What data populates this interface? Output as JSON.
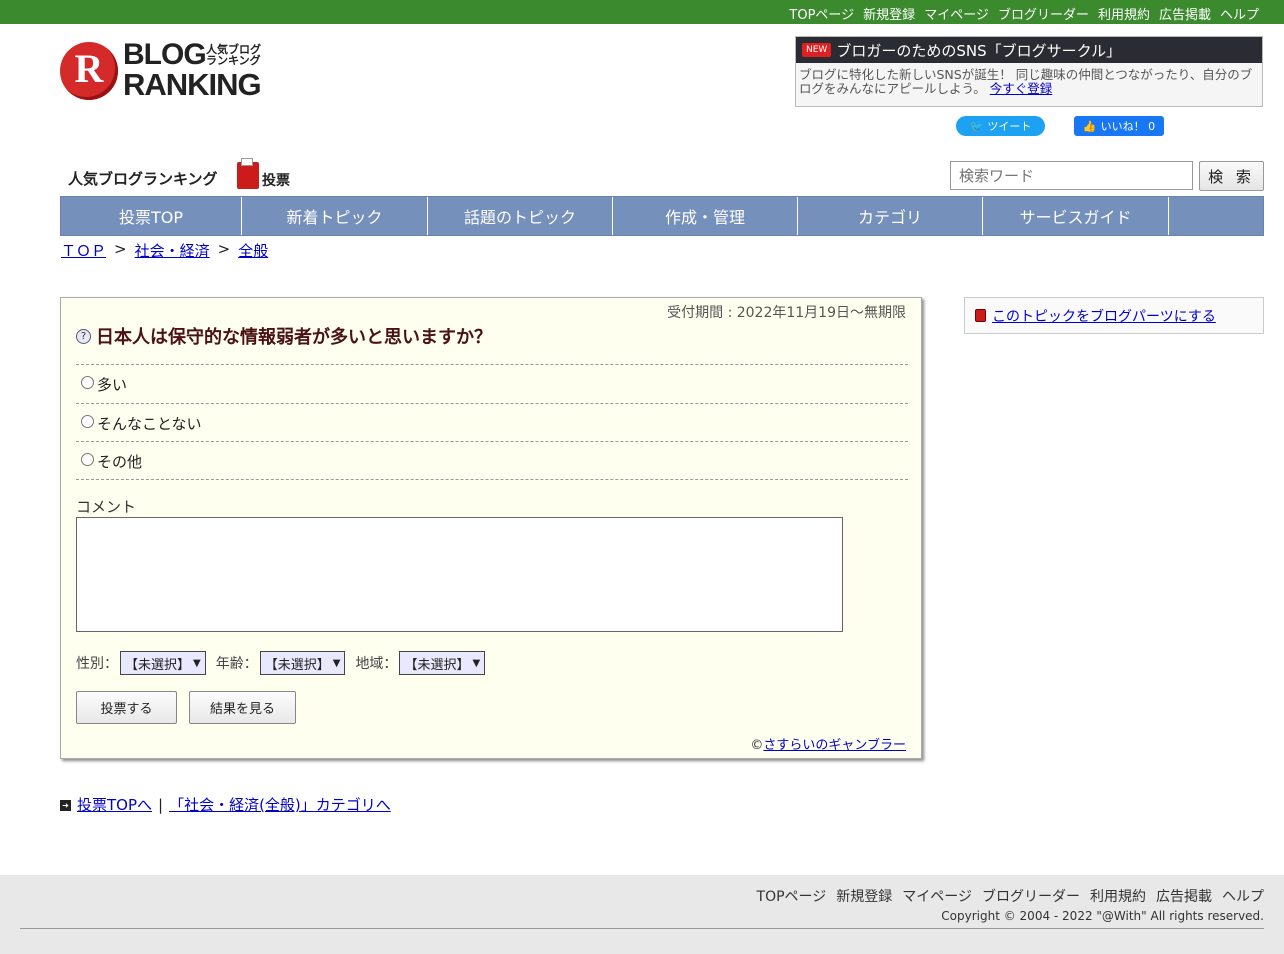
{
  "topbar": {
    "links": [
      "TOPページ",
      "新規登録",
      "マイページ",
      "ブログリーダー",
      "利用規約",
      "広告掲載",
      "ヘルプ"
    ]
  },
  "logo": {
    "letter": "R",
    "line1": "BLOG",
    "line2": "RANKING",
    "jp1": "人気ブログ",
    "jp2": "ランキング"
  },
  "promo": {
    "badge": "NEW",
    "title": "ブロガーのためのSNS「ブログサークル」",
    "body": "ブログに特化した新しいSNSが誕生！ 同じ趣味の仲間とつながったり、自分のブログをみんなにアピールしよう。",
    "link": "今すぐ登録"
  },
  "social": {
    "tweet": "ツイート",
    "like": "いいね！ 0"
  },
  "header": {
    "subtitle": "人気ブログランキング",
    "subtitle2": "投票"
  },
  "search": {
    "placeholder": "検索ワード",
    "button": "検 索"
  },
  "nav": [
    "投票TOP",
    "新着トピック",
    "話題のトピック",
    "作成・管理",
    "カテゴリ",
    "サービスガイド",
    ""
  ],
  "breadcrumb": {
    "top": "ＴＯＰ",
    "cat": "社会・経済",
    "sub": "全般",
    "sep": ">"
  },
  "vote": {
    "period": "受付期間 : 2022年11月19日～無期限",
    "question": "日本人は保守的な情報弱者が多いと思いますか？",
    "options": [
      "多い",
      "そんなことない",
      "その他"
    ],
    "comment_label": "コメント",
    "gender_label": "性別：",
    "age_label": "年齢：",
    "region_label": "地域：",
    "unselected": "【未選択】",
    "vote_button": "投票する",
    "result_button": "結果を見る",
    "author_prefix": "©",
    "author": "さすらいのギャンブラー"
  },
  "side": {
    "link": "このトピックをブログパーツにする"
  },
  "bottom": {
    "link1": "投票TOPへ",
    "sep": "|",
    "link2": "「社会・経済(全般)」カテゴリへ"
  },
  "footer": {
    "links": [
      "TOPページ",
      "新規登録",
      "マイページ",
      "ブログリーダー",
      "利用規約",
      "広告掲載",
      "ヘルプ"
    ],
    "copyright": "Copyright © 2004 - 2022 \"@With\" All rights reserved."
  }
}
